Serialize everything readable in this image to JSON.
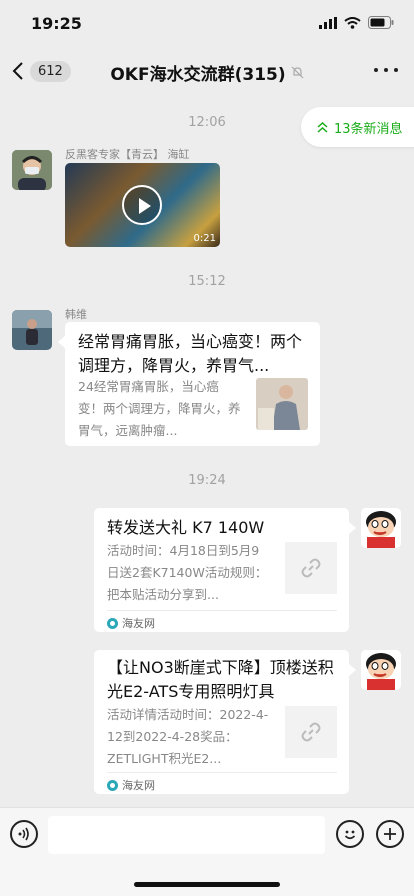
{
  "status_bar": {
    "time": "19:25"
  },
  "header": {
    "back_count": "612",
    "title": "OKF海水交流群(315)"
  },
  "new_messages": {
    "label": "13条新消息"
  },
  "messages": [
    {
      "time": "12:06",
      "sender": "反黑客专家【青云】 海缸",
      "video_duration": "0:21"
    },
    {
      "time": "15:12",
      "sender": "韩维",
      "card_title": "经常胃痛胃胀，当心癌变！两个调理方，降胃火，养胃气...",
      "card_desc": "24经常胃痛胃胀，当心癌变！两个调理方，降胃火，养胃气，远离肿瘤..."
    },
    {
      "time": "19:24",
      "card_title": "转发送大礼 K7 140W",
      "card_desc": "活动时间：4月18日到5月9日送2套K7140W活动规则：把本贴活动分享到...",
      "source": "海友网"
    },
    {
      "card_title": "【让NO3断崖式下降】顶楼送积光E2-ATS专用照明灯具",
      "card_desc": "活动详情活动时间：2022-4-12到2022-4-28奖品：ZETLIGHT积光E2...",
      "source": "海友网"
    }
  ],
  "icons": {
    "back": "chevron-left-icon",
    "mute": "bell-off-icon",
    "more": "more-icon",
    "voice": "voice-icon",
    "emoji": "emoji-icon",
    "add": "plus-icon",
    "link": "link-icon"
  },
  "colors": {
    "accent": "#1aad19",
    "background": "#ededed"
  }
}
